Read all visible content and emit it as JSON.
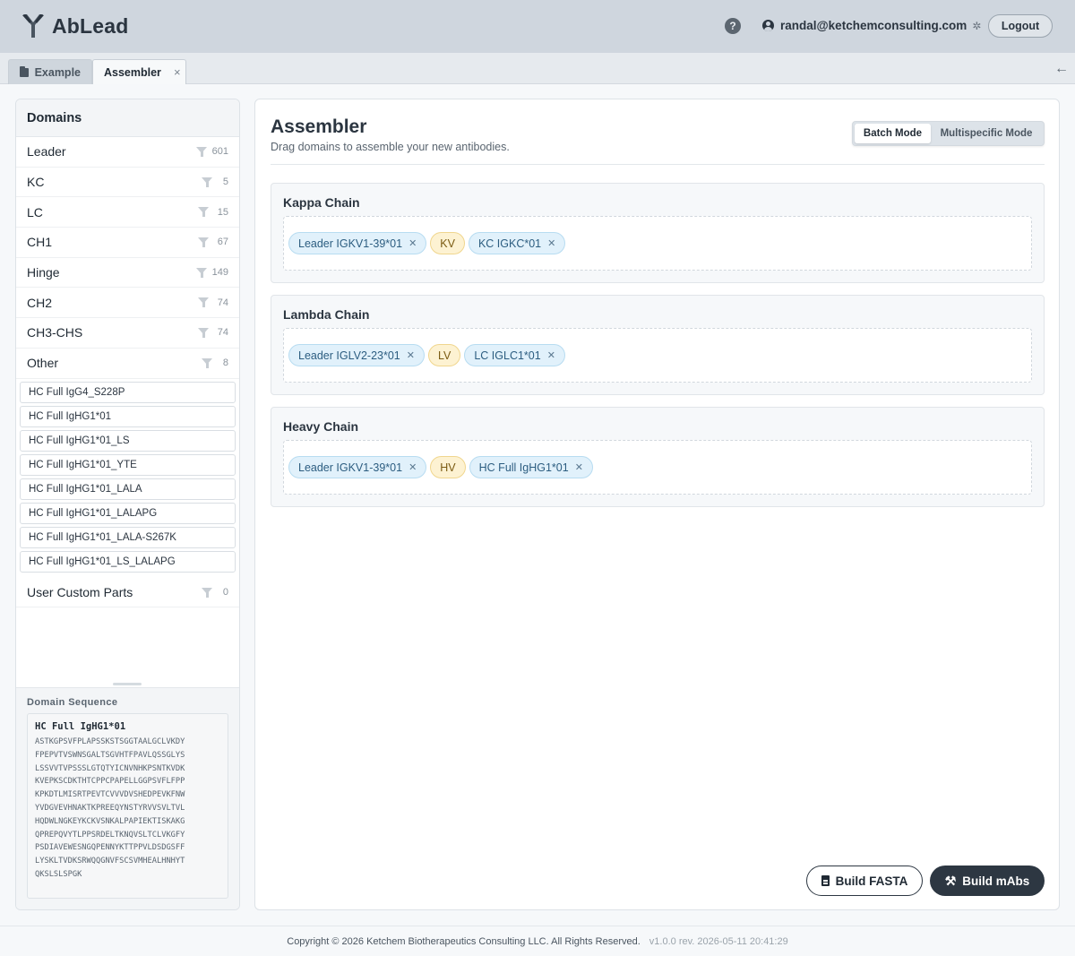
{
  "app": {
    "name": "AbLead"
  },
  "header": {
    "user_email": "randal@ketchemconsulting.com",
    "logout_label": "Logout",
    "help_glyph": "?"
  },
  "tabs": [
    {
      "label": "Example",
      "icon": "folder-icon"
    },
    {
      "label": "Assembler",
      "close": "×"
    }
  ],
  "sidebar": {
    "title": "Domains",
    "categories": [
      {
        "label": "Leader",
        "count": "601"
      },
      {
        "label": "KC",
        "count": "5"
      },
      {
        "label": "LC",
        "count": "15"
      },
      {
        "label": "CH1",
        "count": "67"
      },
      {
        "label": "Hinge",
        "count": "149"
      },
      {
        "label": "CH2",
        "count": "74"
      },
      {
        "label": "CH3-CHS",
        "count": "74"
      },
      {
        "label": "Other",
        "count": "8"
      }
    ],
    "other_items": [
      "HC Full IgG4_S228P",
      "HC Full IgHG1*01",
      "HC Full IgHG1*01_LS",
      "HC Full IgHG1*01_YTE",
      "HC Full IgHG1*01_LALA",
      "HC Full IgHG1*01_LALAPG",
      "HC Full IgHG1*01_LALA-S267K",
      "HC Full IgHG1*01_LS_LALAPG"
    ],
    "custom": {
      "label": "User Custom Parts",
      "count": "0"
    },
    "sequence": {
      "label": "Domain Sequence",
      "title": "HC Full IgHG1*01",
      "lines": [
        "ASTKGPSVFPLAPSSKSTSGGTAALGCLVKDY",
        "FPEPVTVSWNSGALTSGVHTFPAVLQSSGLYS",
        "LSSVVTVPSSSLGTQTYICNVNHKPSNTKVDK",
        "KVEPKSCDKTHTCPPCPAPELLGGPSVFLFPP",
        "KPKDTLMISRTPEVTCVVVDVSHEDPEVKFNW",
        "YVDGVEVHNAKTKPREEQYNSTYRVVSVLTVL",
        "HQDWLNGKEYKCKVSNKALPAPIEKTISKAKG",
        "QPREPQVYTLPPSRDELTKNQVSLTCLVKGFY",
        "PSDIAVEWESNGQPENNYKTTPPVLDSDGSFF",
        "LYSKLTVDKSRWQQGNVFSCSVMHEALHNHYT",
        "QKSLSLSPGK"
      ]
    }
  },
  "main": {
    "title": "Assembler",
    "subtitle": "Drag domains to assemble your new antibodies.",
    "modes": {
      "batch": "Batch Mode",
      "multispecific": "Multispecific Mode"
    },
    "chains": [
      {
        "title": "Kappa Chain",
        "parts": [
          {
            "label": "Leader IGKV1-39*01",
            "color": "blue",
            "removable": true
          },
          {
            "label": "KV",
            "color": "yellow",
            "removable": false
          },
          {
            "label": "KC IGKC*01",
            "color": "blue",
            "removable": true
          }
        ]
      },
      {
        "title": "Lambda Chain",
        "parts": [
          {
            "label": "Leader IGLV2-23*01",
            "color": "blue",
            "removable": true
          },
          {
            "label": "LV",
            "color": "yellow",
            "removable": false
          },
          {
            "label": "LC IGLC1*01",
            "color": "blue",
            "removable": true
          }
        ]
      },
      {
        "title": "Heavy Chain",
        "parts": [
          {
            "label": "Leader IGKV1-39*01",
            "color": "blue",
            "removable": true
          },
          {
            "label": "HV",
            "color": "yellow",
            "removable": false
          },
          {
            "label": "HC Full IgHG1*01",
            "color": "blue",
            "removable": true
          }
        ]
      }
    ],
    "build_fasta_label": "Build FASTA",
    "build_mabs_label": "Build mAbs"
  },
  "footer": {
    "copyright": "Copyright © 2026 Ketchem Biotherapeutics Consulting LLC. All Rights Reserved.",
    "version": "v1.0.0 rev. 2026-05-11 20:41:29"
  },
  "colors": {
    "header_bg": "#cfd6de",
    "primary_dark": "#2d3742",
    "chip_blue": "#e1f1fb",
    "chip_yellow": "#fdf2d2"
  }
}
